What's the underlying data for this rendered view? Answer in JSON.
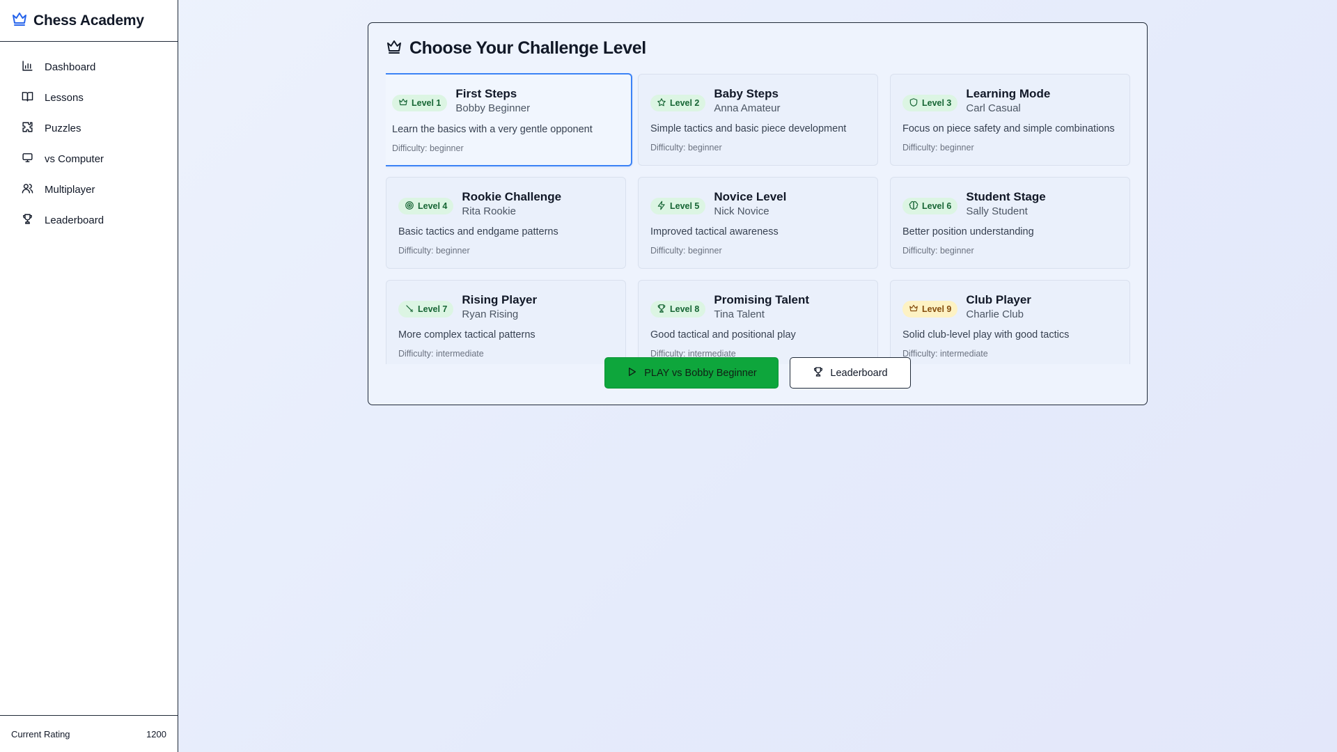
{
  "app": {
    "name": "Chess Academy",
    "brand_color": "#2563eb"
  },
  "sidebar": {
    "items": [
      {
        "label": "Dashboard",
        "icon": "bar-chart-icon"
      },
      {
        "label": "Lessons",
        "icon": "book-open-icon"
      },
      {
        "label": "Puzzles",
        "icon": "puzzle-icon"
      },
      {
        "label": "vs Computer",
        "icon": "monitor-icon"
      },
      {
        "label": "Multiplayer",
        "icon": "users-icon"
      },
      {
        "label": "Leaderboard",
        "icon": "trophy-icon"
      }
    ],
    "footer": {
      "label": "Current Rating",
      "value": "1200"
    }
  },
  "panel": {
    "title": "Choose Your Challenge Level",
    "title_icon": "crown-icon"
  },
  "levels": [
    {
      "badge": "Level 1",
      "icon": "crown-icon",
      "title": "First Steps",
      "opponent": "Bobby Beginner",
      "description": "Learn the basics with a very gentle opponent",
      "difficulty": "Difficulty: beginner",
      "selected": true
    },
    {
      "badge": "Level 2",
      "icon": "star-icon",
      "title": "Baby Steps",
      "opponent": "Anna Amateur",
      "description": "Simple tactics and basic piece development",
      "difficulty": "Difficulty: beginner"
    },
    {
      "badge": "Level 3",
      "icon": "shield-icon",
      "title": "Learning Mode",
      "opponent": "Carl Casual",
      "description": "Focus on piece safety and simple combinations",
      "difficulty": "Difficulty: beginner"
    },
    {
      "badge": "Level 4",
      "icon": "target-icon",
      "title": "Rookie Challenge",
      "opponent": "Rita Rookie",
      "description": "Basic tactics and endgame patterns",
      "difficulty": "Difficulty: beginner"
    },
    {
      "badge": "Level 5",
      "icon": "lightning-icon",
      "title": "Novice Level",
      "opponent": "Nick Novice",
      "description": "Improved tactical awareness",
      "difficulty": "Difficulty: beginner"
    },
    {
      "badge": "Level 6",
      "icon": "brain-icon",
      "title": "Student Stage",
      "opponent": "Sally Student",
      "description": "Better position understanding",
      "difficulty": "Difficulty: beginner"
    },
    {
      "badge": "Level 7",
      "icon": "sword-icon",
      "title": "Rising Player",
      "opponent": "Ryan Rising",
      "description": "More complex tactical patterns",
      "difficulty": "Difficulty: intermediate"
    },
    {
      "badge": "Level 8",
      "icon": "trophy-icon",
      "title": "Promising Talent",
      "opponent": "Tina Talent",
      "description": "Good tactical and positional play",
      "difficulty": "Difficulty: intermediate"
    },
    {
      "badge": "Level 9",
      "icon": "crown-icon",
      "title": "Club Player",
      "opponent": "Charlie Club",
      "description": "Solid club-level play with good tactics",
      "difficulty": "Difficulty: intermediate",
      "badge_style": "gold"
    }
  ],
  "actions": {
    "play_label": "PLAY vs Bobby Beginner",
    "leaderboard_label": "Leaderboard",
    "play_color": "#0ea63c"
  }
}
